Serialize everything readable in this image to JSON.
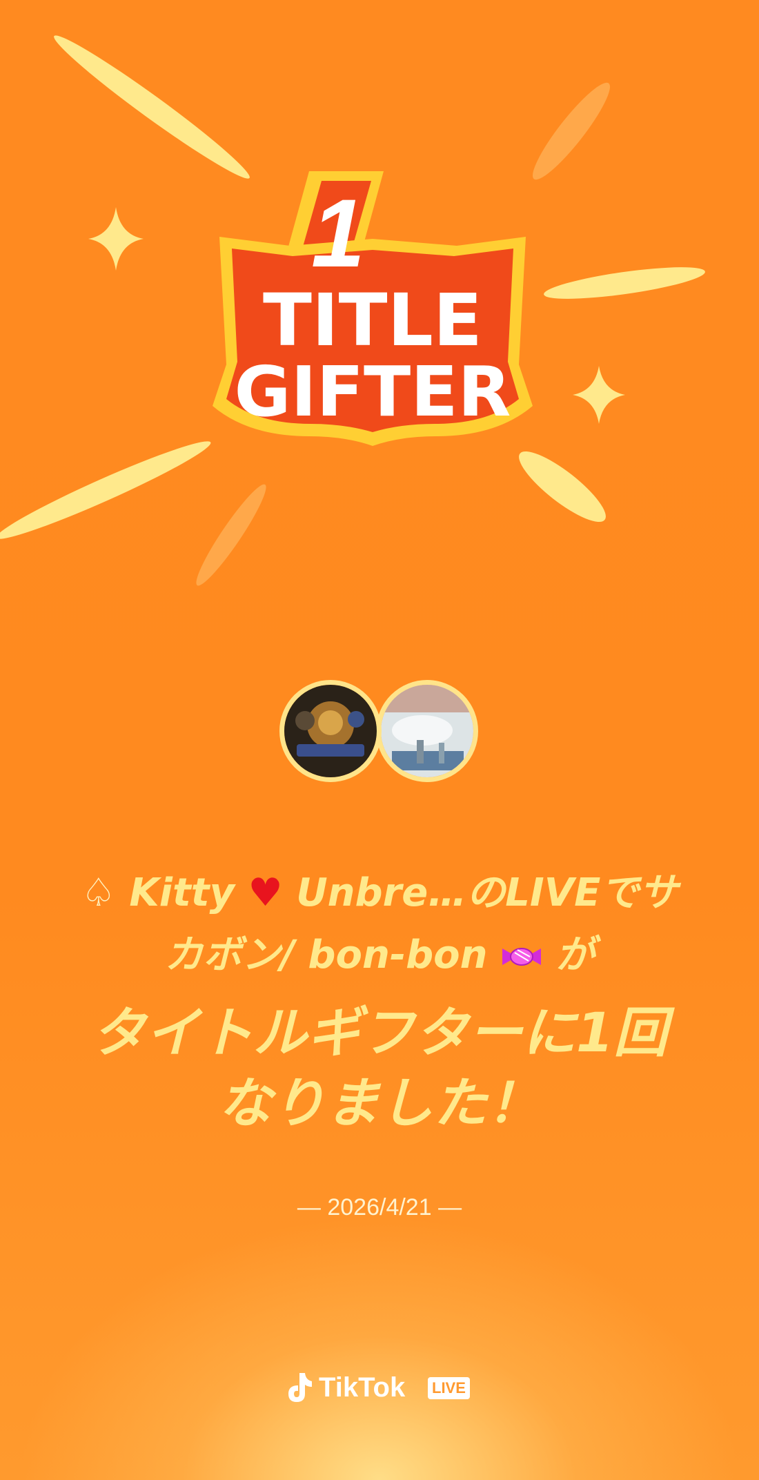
{
  "logo": {
    "rank": "1",
    "line1": "TITLE",
    "line2": "GIFTER"
  },
  "message": {
    "line1_name1": "Kitty",
    "line1_rest": "Unbre…のLIVEでサ",
    "line2_text": "カボン/ bon-bon",
    "line2_suffix": "が",
    "title_line1": "タイトルギフターに1回",
    "title_line2": "なりました！"
  },
  "icons": {
    "spade": "spade-icon",
    "heart": "heart-icon",
    "candy": "candy-icon"
  },
  "date": "— 2026/4/21 —",
  "brand": {
    "name": "TikTok",
    "badge": "LIVE"
  },
  "colors": {
    "background": "#ff8a1c",
    "text_highlight": "#ffe98c",
    "logo_red": "#f04a1a",
    "logo_outline": "#ffcf33"
  }
}
